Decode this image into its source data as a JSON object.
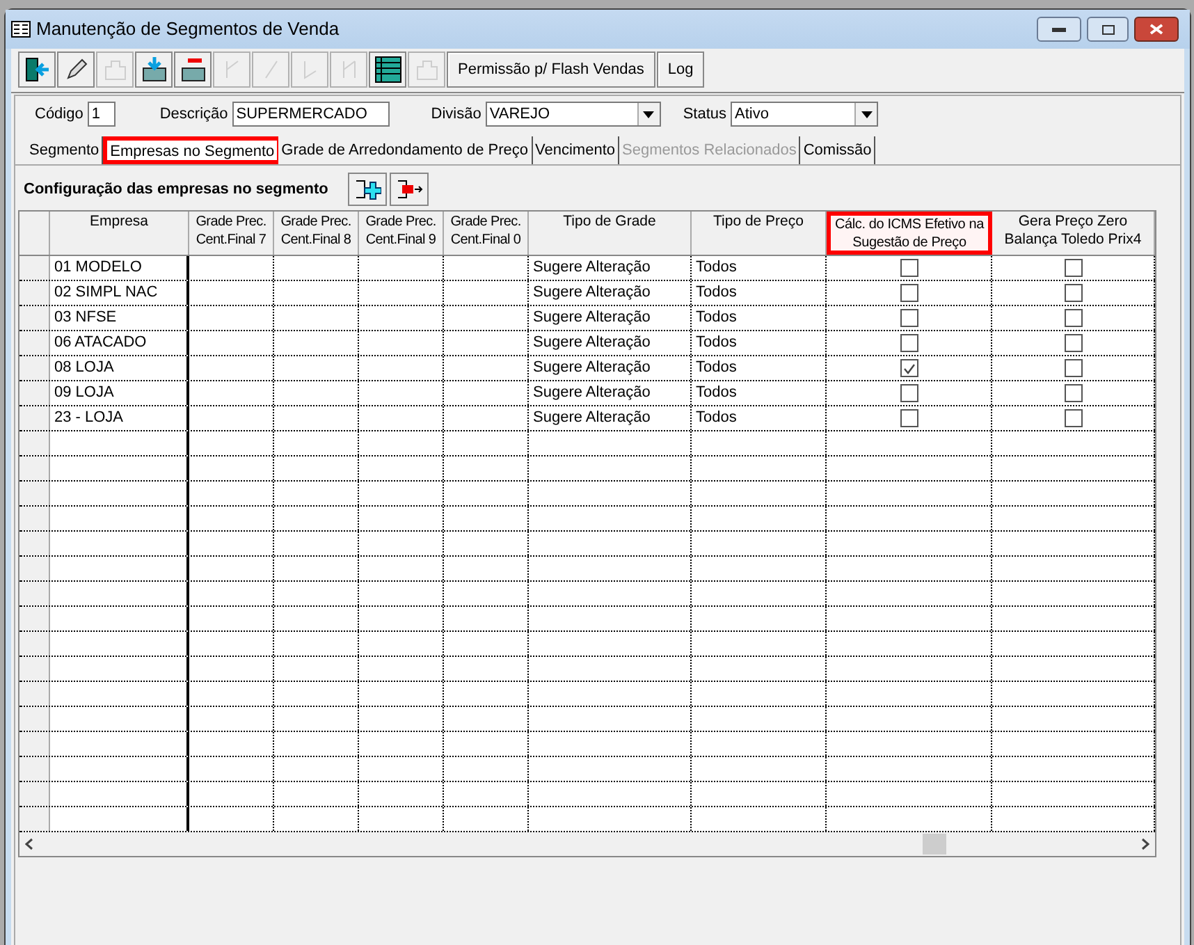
{
  "window": {
    "title": "Manutenção de Segmentos de Venda"
  },
  "toolbar": [
    {
      "kind": "icon",
      "disabled": false
    },
    {
      "kind": "icon",
      "disabled": false
    },
    {
      "kind": "icon",
      "disabled": true
    },
    {
      "kind": "icon",
      "disabled": false
    },
    {
      "kind": "icon",
      "disabled": false
    },
    {
      "kind": "icon",
      "disabled": true
    },
    {
      "kind": "icon",
      "disabled": true
    },
    {
      "kind": "icon",
      "disabled": true
    },
    {
      "kind": "icon",
      "disabled": true
    },
    {
      "kind": "icon",
      "disabled": false
    },
    {
      "kind": "icon",
      "disabled": true
    },
    {
      "kind": "text",
      "label": "Permissão p/ Flash Vendas",
      "disabled": false
    },
    {
      "kind": "text",
      "label": "Log",
      "disabled": false
    }
  ],
  "form": {
    "codigo": {
      "label": "Código",
      "value": "1"
    },
    "descricao": {
      "label": "Descrição",
      "value": "SUPERMERCADO"
    },
    "divisao": {
      "label": "Divisão",
      "value": "VAREJO"
    },
    "status": {
      "label": "Status",
      "value": "Ativo"
    }
  },
  "tabs": [
    {
      "label": "Segmento",
      "selected": false,
      "disabled": false,
      "highlighted": false
    },
    {
      "label": "Empresas no Segmento",
      "selected": true,
      "disabled": false,
      "highlighted": true
    },
    {
      "label": "Grade de Arredondamento de Preço",
      "selected": false,
      "disabled": false,
      "highlighted": false
    },
    {
      "label": "Vencimento",
      "selected": false,
      "disabled": false,
      "highlighted": false
    },
    {
      "label": "Segmentos Relacionados",
      "selected": false,
      "disabled": true,
      "highlighted": false
    },
    {
      "label": "Comissão",
      "selected": false,
      "disabled": false,
      "highlighted": false
    }
  ],
  "section_title": "Configuração das empresas no segmento",
  "table": {
    "columns": [
      {
        "label": "Empresa",
        "kind": "text",
        "highlighted": false
      },
      {
        "label": "Grade Prec. Cent.Final 7",
        "kind": "text",
        "highlighted": false
      },
      {
        "label": "Grade Prec. Cent.Final 8",
        "kind": "text",
        "highlighted": false
      },
      {
        "label": "Grade Prec. Cent.Final 9",
        "kind": "text",
        "highlighted": false
      },
      {
        "label": "Grade Prec. Cent.Final 0",
        "kind": "text",
        "highlighted": false
      },
      {
        "label": "Tipo de Grade",
        "kind": "text",
        "highlighted": false
      },
      {
        "label": "Tipo de Preço",
        "kind": "text",
        "highlighted": false
      },
      {
        "label": "Cálc. do ICMS Efetivo na Sugestão de Preço",
        "kind": "check",
        "highlighted": true
      },
      {
        "label": "Gera Preço Zero Balança Toledo Prix4",
        "kind": "check",
        "highlighted": false
      }
    ],
    "rows": [
      {
        "empresa": "01 MODELO",
        "tipo_grade": "Sugere Alteração",
        "tipo_preco": "Todos",
        "icms_checked": false,
        "prix4_checked": false
      },
      {
        "empresa": "02 SIMPL NAC",
        "tipo_grade": "Sugere Alteração",
        "tipo_preco": "Todos",
        "icms_checked": false,
        "prix4_checked": false
      },
      {
        "empresa": "03 NFSE",
        "tipo_grade": "Sugere Alteração",
        "tipo_preco": "Todos",
        "icms_checked": false,
        "prix4_checked": false
      },
      {
        "empresa": "06 ATACADO",
        "tipo_grade": "Sugere Alteração",
        "tipo_preco": "Todos",
        "icms_checked": false,
        "prix4_checked": false
      },
      {
        "empresa": "08 LOJA",
        "tipo_grade": "Sugere Alteração",
        "tipo_preco": "Todos",
        "icms_checked": true,
        "prix4_checked": false
      },
      {
        "empresa": "09 LOJA",
        "tipo_grade": "Sugere Alteração",
        "tipo_preco": "Todos",
        "icms_checked": false,
        "prix4_checked": false
      },
      {
        "empresa": "23 - LOJA",
        "tipo_grade": "Sugere Alteração",
        "tipo_preco": "Todos",
        "icms_checked": false,
        "prix4_checked": false
      }
    ]
  }
}
